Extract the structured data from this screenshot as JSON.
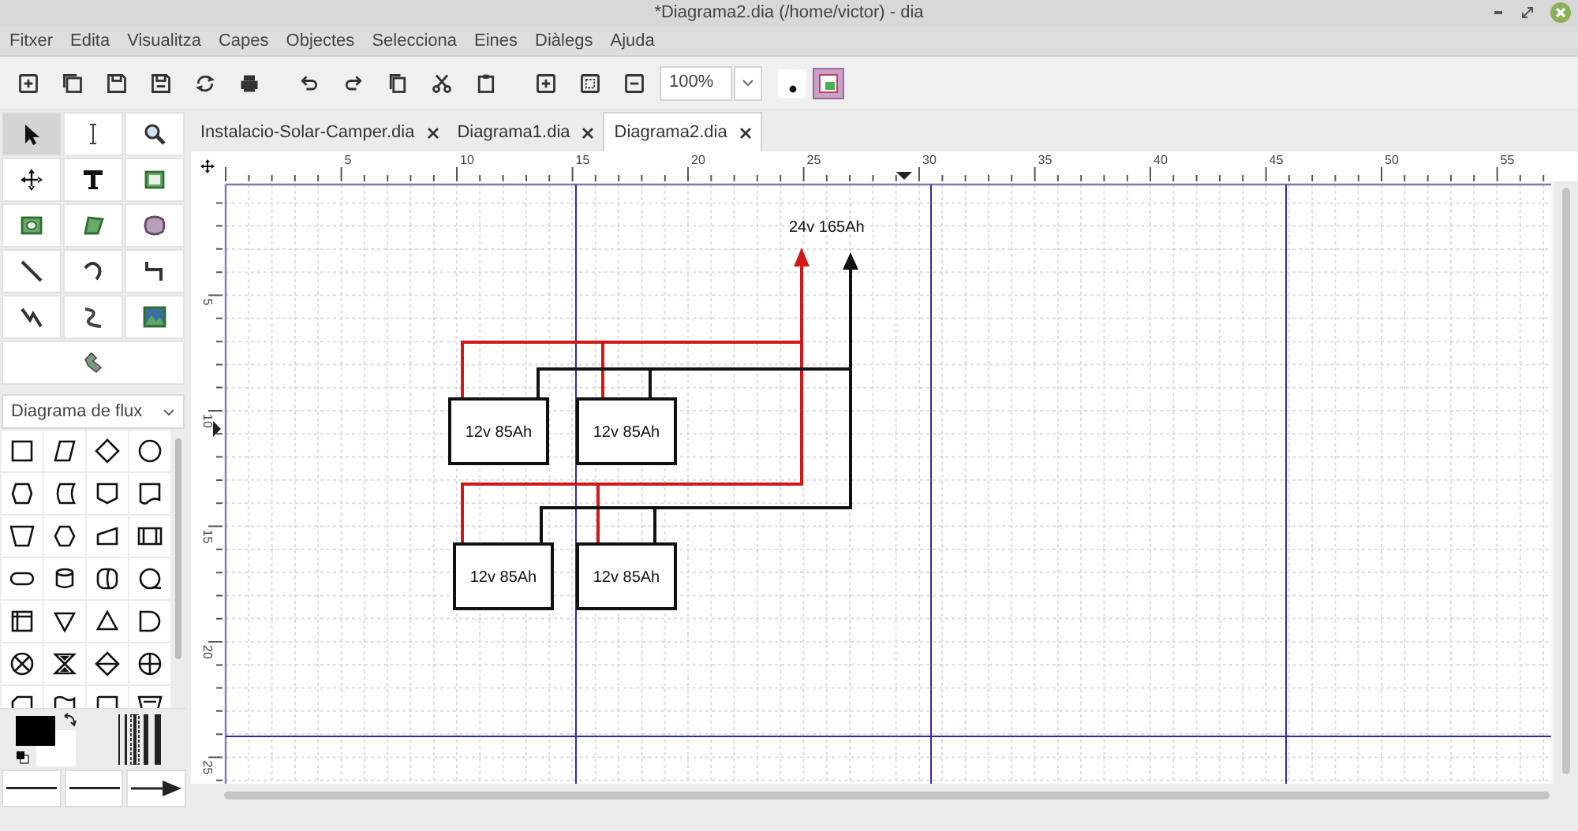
{
  "window": {
    "title": "*Diagrama2.dia (/home/victor) - dia"
  },
  "menu": [
    "Fitxer",
    "Edita",
    "Visualitza",
    "Capes",
    "Objectes",
    "Selecciona",
    "Eines",
    "Diàlegs",
    "Ajuda"
  ],
  "toolbar": {
    "zoom": "100%"
  },
  "toolbox": {
    "tools": [
      {
        "selected": true
      },
      {
        "selected": false
      },
      {
        "selected": false
      },
      {
        "selected": false
      },
      {
        "selected": false
      },
      {
        "selected": false
      },
      {
        "selected": false
      },
      {
        "selected": false
      },
      {
        "selected": false
      },
      {
        "selected": false
      },
      {
        "selected": false
      },
      {
        "selected": false
      },
      {
        "selected": false
      },
      {
        "selected": false
      },
      {
        "selected": false
      },
      {
        "selected": false
      }
    ],
    "sheet": "Diagrama de flux"
  },
  "tabs": [
    {
      "label": "Instalacio-Solar-Camper.dia",
      "selected": false
    },
    {
      "label": "Diagrama1.dia",
      "selected": false
    },
    {
      "label": "Diagrama2.dia",
      "selected": true
    }
  ],
  "rulers": {
    "horizontal": [
      "5",
      "10",
      "15",
      "20",
      "25",
      "30",
      "35",
      "40",
      "45",
      "50",
      "55"
    ],
    "vertical": [
      "5",
      "10",
      "15",
      "20",
      "25"
    ]
  },
  "diagram": {
    "output_label": "24v 165Ah",
    "batteries": [
      {
        "label": "12v 85Ah"
      },
      {
        "label": "12v 85Ah"
      },
      {
        "label": "12v 85Ah"
      },
      {
        "label": "12v 85Ah"
      }
    ]
  }
}
